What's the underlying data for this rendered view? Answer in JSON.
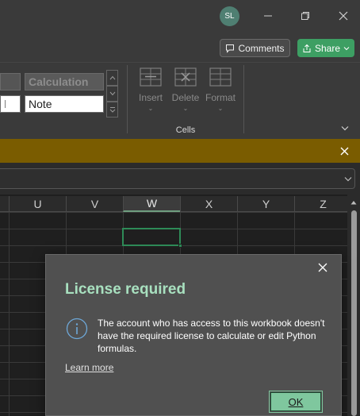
{
  "titlebar": {
    "avatar_initials": "SL",
    "minimize_icon": "minimize-icon",
    "restore_icon": "restore-icon",
    "close_icon": "close-icon"
  },
  "actionbar": {
    "comments_label": "Comments",
    "share_label": "Share"
  },
  "ribbon": {
    "styles": {
      "row1": {
        "left_partial": "",
        "calculation": "Calculation"
      },
      "row2": {
        "left_partial": "l",
        "note": "Note"
      }
    },
    "cells_group": {
      "label": "Cells",
      "buttons": [
        {
          "label": "Insert",
          "icon": "insert-cells-icon"
        },
        {
          "label": "Delete",
          "icon": "delete-cells-icon"
        },
        {
          "label": "Format",
          "icon": "format-cells-icon"
        }
      ]
    }
  },
  "grid": {
    "columns": [
      "U",
      "V",
      "W",
      "X",
      "Y",
      "Z"
    ],
    "selected_column": "W"
  },
  "dialog": {
    "title": "License required",
    "message": "The account who has access to this workbook doesn't have the required license to calculate or edit Python formulas.",
    "link": "Learn more",
    "ok_label": "OK"
  },
  "colors": {
    "accent_green": "#3d9f63",
    "message_bar": "#7a5c00",
    "dialog_title": "#a8e0bf",
    "ok_button": "#7fc79e"
  }
}
